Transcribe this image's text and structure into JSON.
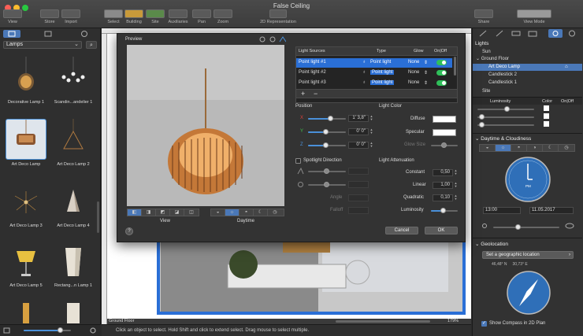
{
  "window": {
    "title": "False Ceiling"
  },
  "toolbar": {
    "view": "View",
    "store": "Store",
    "import": "Import",
    "select": "Select",
    "building": "Building",
    "site": "Site",
    "auxiliaries": "Auxiliaries",
    "pan": "Pan",
    "zoom": "Zoom",
    "representation": "2D Representation",
    "share": "Share",
    "view_mode": "View Mode"
  },
  "left_panel": {
    "category": "Lamps",
    "items": [
      {
        "label": "Decorative Lamp 1"
      },
      {
        "label": "Scandin...andelier 1"
      },
      {
        "label": "Art Deco Lamp"
      },
      {
        "label": "Art Deco Lamp 2"
      },
      {
        "label": "Art Deco Lamp 3"
      },
      {
        "label": "Art Deco Lamp 4"
      },
      {
        "label": "Art Deco Lamp 5"
      },
      {
        "label": "Rectang...n Lamp 1"
      }
    ]
  },
  "canvas": {
    "level": "Ground Floor",
    "zoom": "179%"
  },
  "status": {
    "hint": "Click an object to select. Hold Shift and click to extend select. Drag mouse to select multiple."
  },
  "dialog": {
    "preview_title": "Preview",
    "table_headers": {
      "source": "Light Sources",
      "type": "Type",
      "glow": "Glow",
      "onoff": "On|Off"
    },
    "rows": [
      {
        "name": "Point light #1",
        "type": "Point light",
        "glow": "None"
      },
      {
        "name": "Point light #2",
        "type": "Point light",
        "glow": "None"
      },
      {
        "name": "Point light #3",
        "type": "Point light",
        "glow": "None"
      }
    ],
    "add": "+",
    "remove": "−",
    "position": {
      "title": "Position",
      "x_label": "X",
      "y_label": "Y",
      "z_label": "Z",
      "x": "1' 3,8\"",
      "y": "0' 0\"",
      "z": "0' 0\""
    },
    "spotlight": {
      "title": "Spotlight Direction",
      "angle": "Angle",
      "falloff": "Falloff"
    },
    "light_color": {
      "title": "Light Color",
      "diffuse": "Diffuse",
      "specular": "Specular",
      "glow_size": "Glow Size"
    },
    "attenuation": {
      "title": "Light Attenuation",
      "constant_label": "Constant",
      "constant": "0,50",
      "linear_label": "Linear",
      "linear": "1,00",
      "quadratic_label": "Quadratic",
      "quadratic": "0,10",
      "luminosity_label": "Luminosity"
    },
    "view_label": "View",
    "daytime_label": "Daytime",
    "cancel": "Cancel",
    "ok": "OK",
    "help": "?",
    "colors": {
      "diffuse": "#ffffff",
      "specular": "#ffffff",
      "toggle_on": "#2fbf5a",
      "selection": "#2a6fd6"
    }
  },
  "right_panel": {
    "lights_title": "Lights",
    "tree": {
      "sun": "Sun",
      "ground_floor": "Ground Floor",
      "art_deco_lamp": "Art Deco Lamp",
      "candlestick2": "Candlestick 2",
      "candlestick1": "Candlestick 1",
      "site": "Site"
    },
    "cols": {
      "luminosity": "Luminosity",
      "color": "Color",
      "onoff": "On|Off"
    },
    "daytime_title": "Daytime & Cloudiness",
    "clock_label": "PM",
    "time": "13:00",
    "date": "11.05.2017",
    "geolocation_title": "Geolocation",
    "geo_button": "Set a geographic location",
    "coords": "46,48° N     30,73° E",
    "show_compass": "Show Compass in 2D Plan"
  }
}
